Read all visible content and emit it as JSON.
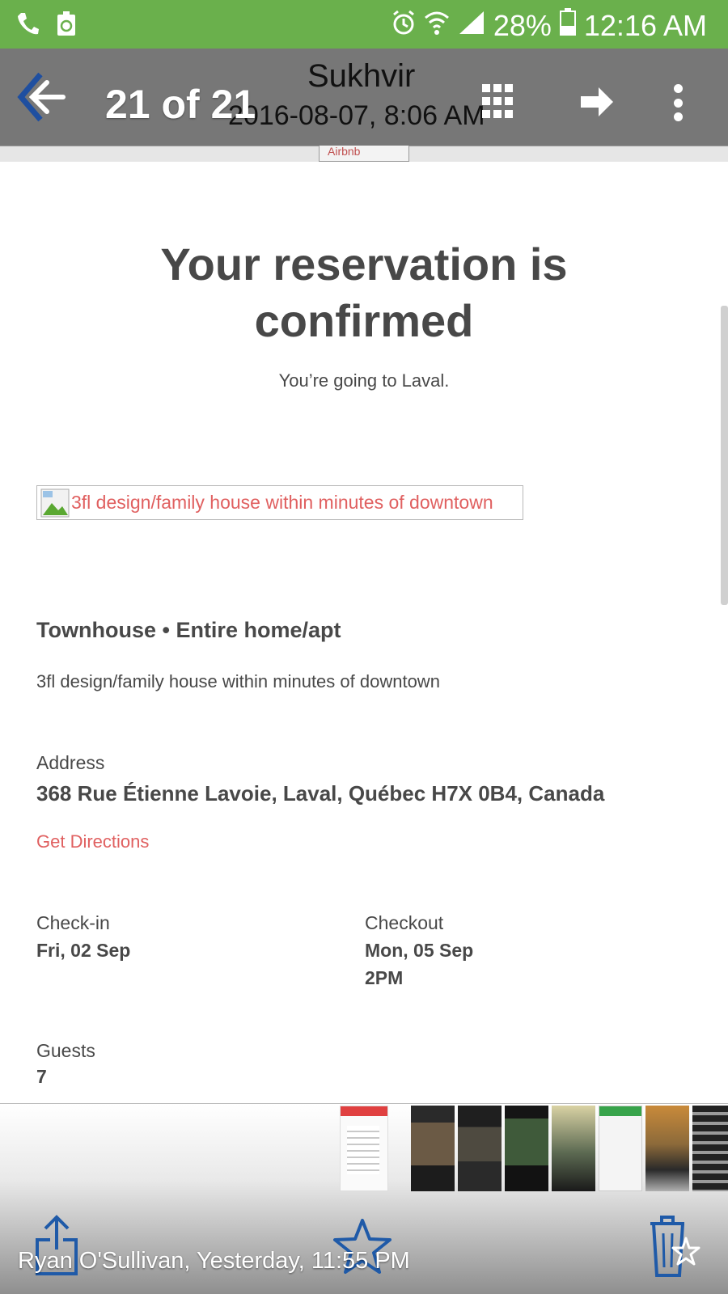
{
  "status_bar": {
    "icons_left": [
      "phone-icon",
      "recycle-notification-icon"
    ],
    "icons_right": [
      "alarm-icon",
      "wifi-icon",
      "signal-icon"
    ],
    "battery": "28%",
    "time": "12:16 AM",
    "background_color": "#6ab04c"
  },
  "gallery_header": {
    "counter": "21 of 21",
    "back_icon": "arrow-left-icon",
    "grid_icon": "grid-icon",
    "forward_icon": "arrow-right-icon",
    "more_icon": "more-vert-icon"
  },
  "email": {
    "sender": "Sukhvir",
    "date": "2016-08-07, 8:06 AM",
    "logo_alt": "Airbnb",
    "headline_line1": "Your reservation is",
    "headline_line2": "confirmed",
    "subtitle": "You’re going to Laval.",
    "image_alt": "3fl design/family house within minutes of downtown",
    "property_type": "Townhouse • Entire home/apt",
    "property_name": "3fl design/family house within minutes of downtown",
    "address_label": "Address",
    "address_value": "368 Rue Étienne Lavoie, Laval, Québec H7X 0B4, Canada",
    "directions_link": "Get Directions",
    "checkin_label": "Check-in",
    "checkin_value": "Fri, 02 Sep",
    "checkout_label": "Checkout",
    "checkout_value": "Mon, 05 Sep",
    "checkout_time": "2PM",
    "guests_label": "Guests",
    "guests_value": "7",
    "link_color": "#e06060"
  },
  "bottom_bar": {
    "comment": "Ryan O'Sullivan, Yesterday, 11:55 PM",
    "share_icon": "share-icon",
    "favorite_icon": "star-outline-icon",
    "delete_icon": "trash-icon"
  }
}
